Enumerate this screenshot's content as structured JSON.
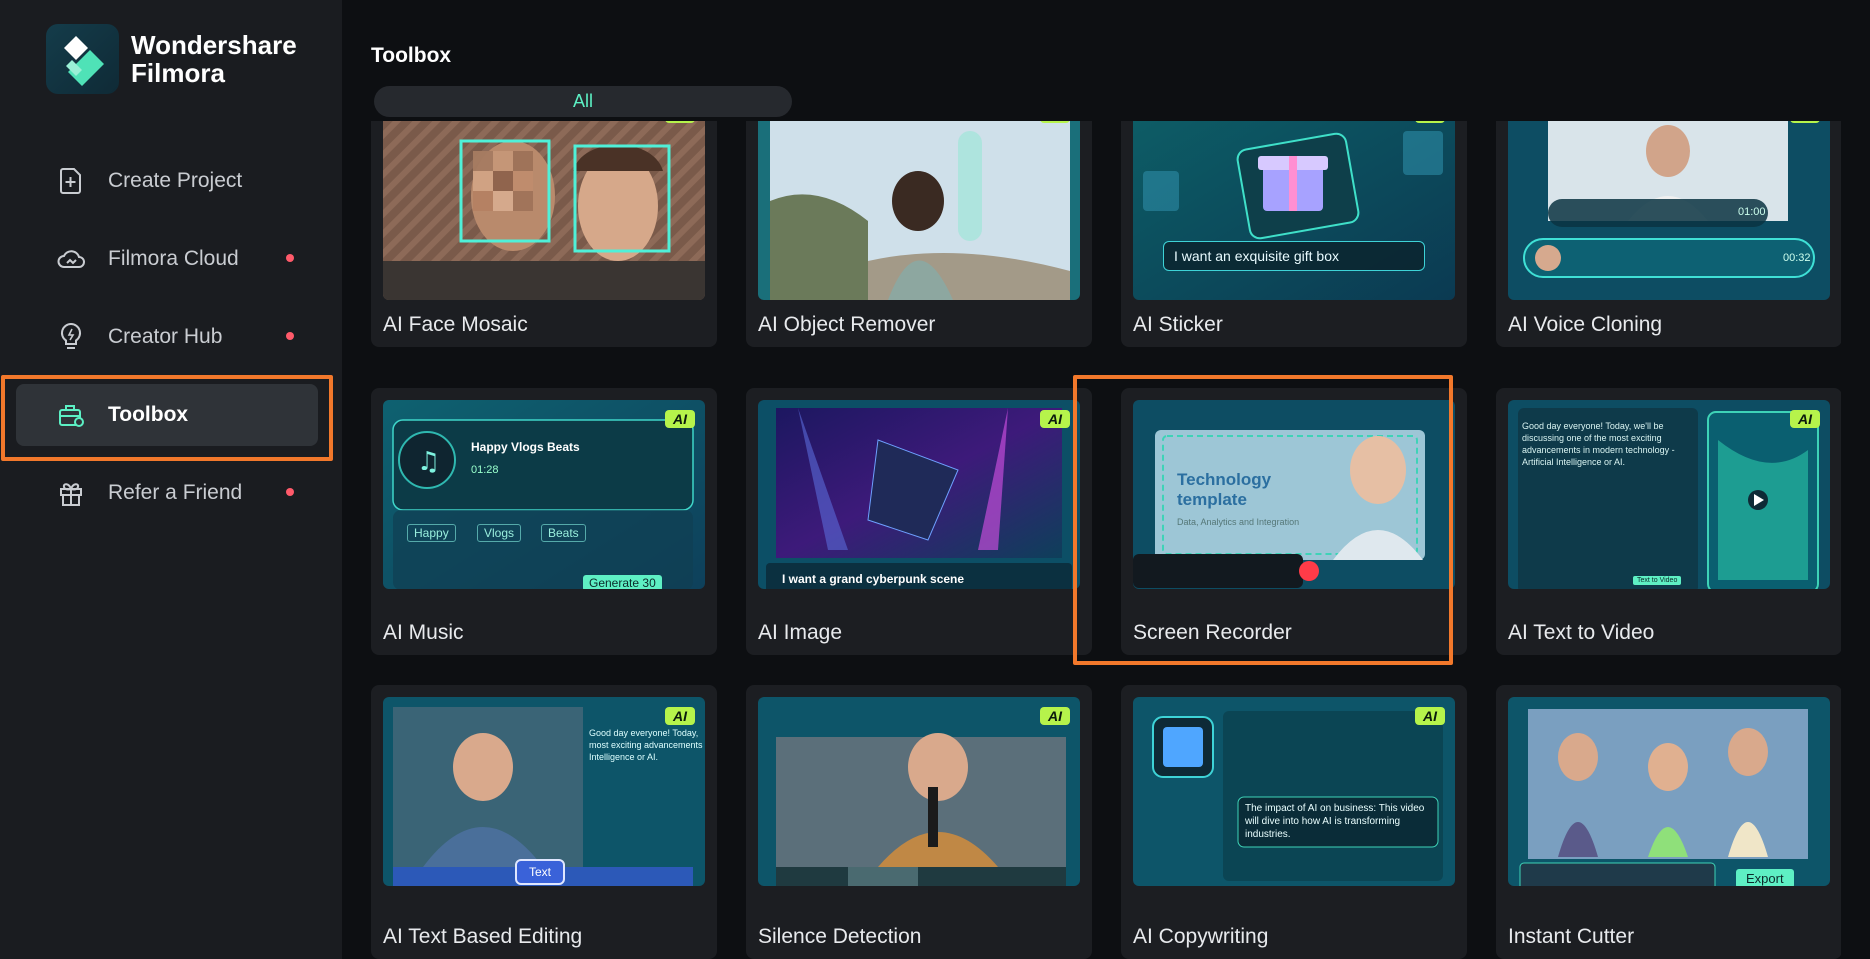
{
  "app": {
    "name_line1": "Wondershare",
    "name_line2": "Filmora"
  },
  "sidebar": {
    "items": [
      {
        "label": "Create Project",
        "icon": "create-project-icon",
        "dot": false
      },
      {
        "label": "Filmora Cloud",
        "icon": "cloud-icon",
        "dot": true
      },
      {
        "label": "Creator Hub",
        "icon": "bulb-icon",
        "dot": true
      },
      {
        "label": "Toolbox",
        "icon": "toolbox-icon",
        "dot": false,
        "active": true
      },
      {
        "label": "Refer a Friend",
        "icon": "gift-icon",
        "dot": true
      }
    ]
  },
  "main": {
    "title": "Toolbox",
    "filter": "All",
    "ai_badge": "AI",
    "tools": [
      {
        "name": "AI Face Mosaic"
      },
      {
        "name": "AI Object Remover"
      },
      {
        "name": "AI Sticker",
        "thumb_text": "I want an exquisite gift box"
      },
      {
        "name": "AI Voice Cloning",
        "times": [
          "01:00",
          "00:32"
        ]
      },
      {
        "name": "AI Music",
        "song_title": "Happy Vlogs Beats",
        "duration": "01:28",
        "tags": [
          "Happy",
          "Vlogs",
          "Beats"
        ],
        "generate_label": "Generate",
        "credits": "30"
      },
      {
        "name": "AI Image",
        "thumb_text": "I want a grand cyberpunk scene"
      },
      {
        "name": "Screen Recorder",
        "slide_title": "Technology template",
        "slide_sub": "Data, Analytics and Integration"
      },
      {
        "name": "AI Text to Video",
        "thumb_text": "Good day everyone! Today, we'll be discussing one of the most exciting advancements in modern technology - Artificial Intelligence or AI.",
        "button": "Text to Video"
      },
      {
        "name": "AI Text Based Editing",
        "thumb_text": "Good day everyone! Today, most exciting advancements Intelligence or AI.",
        "chip": "Text"
      },
      {
        "name": "Silence Detection"
      },
      {
        "name": "AI Copywriting",
        "thumb_text": "The impact of AI on business: This video will dive into how AI is transforming industries."
      },
      {
        "name": "Instant Cutter",
        "button": "Export"
      }
    ]
  },
  "colors": {
    "accent": "#5cf0c4",
    "highlight": "#f2782b",
    "ai_badge": "#b6f34b",
    "dot": "#ff5a6a"
  }
}
